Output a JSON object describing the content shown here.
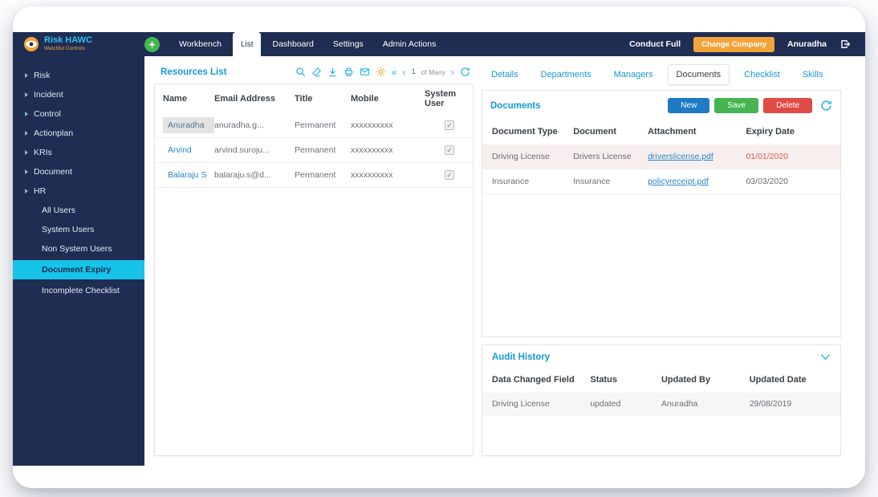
{
  "brand": {
    "title": "Risk HAWC",
    "subtitle": "Watchful Controls"
  },
  "topbar": {
    "menu": [
      {
        "label": "Workbench"
      },
      {
        "label": "List"
      },
      {
        "label": "Dashboard"
      },
      {
        "label": "Settings"
      },
      {
        "label": "Admin Actions"
      }
    ],
    "conduct_label": "Conduct Full",
    "change_company_label": "Change Company",
    "user_name": "Anuradha"
  },
  "sidebar": {
    "items": [
      {
        "label": "Risk"
      },
      {
        "label": "Incident"
      },
      {
        "label": "Control"
      },
      {
        "label": "Actionplan"
      },
      {
        "label": "KRIs"
      },
      {
        "label": "Document"
      },
      {
        "label": "HR",
        "children": [
          {
            "label": "All Users"
          },
          {
            "label": "System Users"
          },
          {
            "label": "Non System Users"
          },
          {
            "label": "Document Expiry",
            "selected": true
          },
          {
            "label": "Incomplete Checklist"
          }
        ]
      }
    ]
  },
  "resources": {
    "title": "Resources List",
    "pagination": {
      "page": "1",
      "of_label": "of Many"
    },
    "columns": [
      "Name",
      "Email Address",
      "Title",
      "Mobile",
      "System User"
    ],
    "rows": [
      {
        "name": "Anuradha",
        "email": "anuradha.g...",
        "title": "Permanent",
        "mobile": "xxxxxxxxxx",
        "system_user": true
      },
      {
        "name": "Arvind",
        "email": "arvind.suroju...",
        "title": "Permanent",
        "mobile": "xxxxxxxxxx",
        "system_user": true
      },
      {
        "name": "Balaraju S",
        "email": "balaraju.s@d...",
        "title": "Permanent",
        "mobile": "xxxxxxxxxx",
        "system_user": true
      }
    ]
  },
  "detail": {
    "tabs": [
      {
        "label": "Details"
      },
      {
        "label": "Departments"
      },
      {
        "label": "Managers"
      },
      {
        "label": "Documents",
        "active": true
      },
      {
        "label": "Checklist"
      },
      {
        "label": "Skills"
      }
    ],
    "documents": {
      "title": "Documents",
      "buttons": {
        "new": "New",
        "save": "Save",
        "delete": "Delete"
      },
      "columns": [
        "Document Type",
        "Document",
        "Attachment",
        "Expiry Date"
      ],
      "rows": [
        {
          "type": "Driving License",
          "document": "Drivers License",
          "attachment": "driverslicense.pdf",
          "expiry": "01/01/2020",
          "expired": true
        },
        {
          "type": "Insurance",
          "document": "Insurance",
          "attachment": "policyreceipt.pdf",
          "expiry": "03/03/2020",
          "expired": false
        }
      ]
    },
    "audit": {
      "title": "Audit History",
      "columns": [
        "Data Changed Field",
        "Status",
        "Updated By",
        "Updated Date"
      ],
      "rows": [
        {
          "field": "Driving License",
          "status": "updated",
          "updated_by": "Anuradha",
          "updated_date": "29/08/2019"
        }
      ]
    }
  },
  "colors": {
    "navbar_navy": "#1f2d52",
    "selected_cyan": "#17c3e8",
    "heading_blue": "#1699d6",
    "change_company_orange": "#f2a33c",
    "new_button_blue": "#1f7ac4",
    "save_button_green": "#46b450",
    "delete_button_red": "#e14b45",
    "expired_date_red": "#e2574c"
  }
}
